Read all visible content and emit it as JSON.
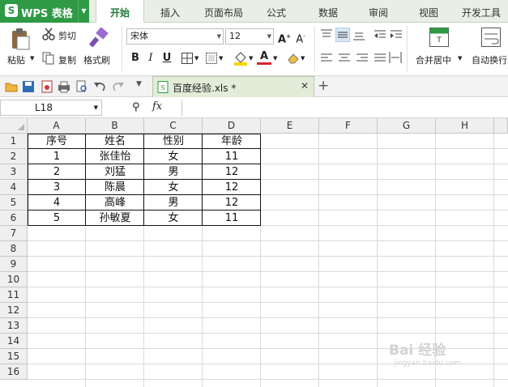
{
  "app": {
    "logo_label": "WPS 表格"
  },
  "menu": {
    "tabs": [
      "开始",
      "插入",
      "页面布局",
      "公式",
      "数据",
      "审阅",
      "视图",
      "开发工具"
    ],
    "active": "开始"
  },
  "ribbon": {
    "paste": "粘贴",
    "cut": "剪切",
    "copy": "复制",
    "format_painter": "格式刷",
    "font_name": "宋体",
    "font_size": "12",
    "merge_center": "合并居中",
    "wrap_text": "自动换行"
  },
  "document": {
    "tab_name": "百度经验.xls *"
  },
  "formula_bar": {
    "cell_ref": "L18",
    "fx": "fx",
    "formula": ""
  },
  "sheet": {
    "columns": [
      "A",
      "B",
      "C",
      "D",
      "E",
      "F",
      "G",
      "H"
    ],
    "rows": [
      "1",
      "2",
      "3",
      "4",
      "5",
      "6",
      "7",
      "8",
      "9",
      "10",
      "11",
      "12",
      "13",
      "14",
      "15",
      "16"
    ],
    "table": [
      [
        "序号",
        "姓名",
        "性别",
        "年龄"
      ],
      [
        "1",
        "张佳怡",
        "女",
        "11"
      ],
      [
        "2",
        "刘猛",
        "男",
        "12"
      ],
      [
        "3",
        "陈晨",
        "女",
        "12"
      ],
      [
        "4",
        "高峰",
        "男",
        "12"
      ],
      [
        "5",
        "孙敏夏",
        "女",
        "11"
      ]
    ]
  },
  "watermark": {
    "text": "Bai 经验",
    "sub": "jingyan.baidu.com"
  },
  "colors": {
    "brand": "#2f9a45",
    "active_tab": "#1e7a36",
    "font_color": "#d9232d",
    "fill_color": "#f5d300"
  },
  "icons": [
    "paste-icon",
    "cut-icon",
    "copy-icon",
    "format-painter-icon",
    "bold-icon",
    "italic-icon",
    "underline-icon",
    "border-icon",
    "fill-color-icon",
    "font-color-icon",
    "align-icon",
    "merge-icon",
    "wrap-icon",
    "open-icon",
    "save-icon",
    "print-icon",
    "undo-icon",
    "redo-icon",
    "zoom-icon"
  ]
}
